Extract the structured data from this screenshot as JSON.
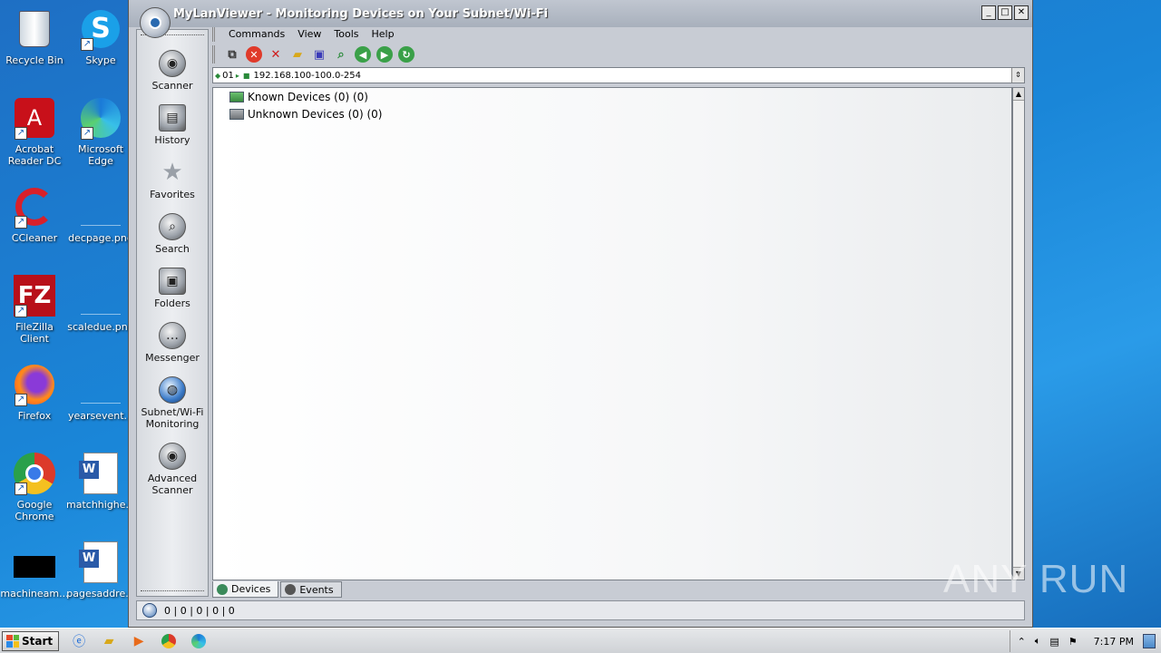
{
  "desktop": {
    "icons": [
      {
        "label": "Recycle Bin",
        "name": "recycle-bin-icon"
      },
      {
        "label": "Skype",
        "name": "skype-icon"
      },
      {
        "label": "Acrobat Reader DC",
        "name": "acrobat-icon"
      },
      {
        "label": "Microsoft Edge",
        "name": "edge-icon"
      },
      {
        "label": "CCleaner",
        "name": "ccleaner-icon"
      },
      {
        "label": "decpage.png",
        "name": "png-file-icon"
      },
      {
        "label": "FileZilla Client",
        "name": "filezilla-icon"
      },
      {
        "label": "scaledue.png",
        "name": "png-file-icon"
      },
      {
        "label": "Firefox",
        "name": "firefox-icon"
      },
      {
        "label": "yearsevent...",
        "name": "file-icon"
      },
      {
        "label": "Google Chrome",
        "name": "chrome-icon"
      },
      {
        "label": "matchhighe...",
        "name": "word-doc-icon"
      },
      {
        "label": "machineam...",
        "name": "black-file-icon"
      },
      {
        "label": "pagesaddre...",
        "name": "word-doc-icon"
      }
    ]
  },
  "window": {
    "title": "MyLanViewer - Monitoring Devices on Your Subnet/Wi-Fi",
    "minimize": "_",
    "maximize": "□",
    "close": "✕"
  },
  "sidebar": {
    "items": [
      {
        "label": "Scanner"
      },
      {
        "label": "History"
      },
      {
        "label": "Favorites"
      },
      {
        "label": "Search"
      },
      {
        "label": "Folders"
      },
      {
        "label": "Messenger"
      },
      {
        "label": "Subnet/Wi-Fi Monitoring"
      },
      {
        "label": "Advanced Scanner"
      }
    ]
  },
  "menu": {
    "commands": "Commands",
    "view": "View",
    "tools": "Tools",
    "help": "Help"
  },
  "address": {
    "prefix": "01",
    "range": "192.168.100-100.0-254"
  },
  "tree": {
    "known": "Known Devices (0) (0)",
    "unknown": "Unknown Devices (0) (0)"
  },
  "tabs": {
    "devices": "Devices",
    "events": "Events"
  },
  "status": {
    "text": "0 | 0 | 0 | 0 | 0"
  },
  "watermark": "ANY RUN",
  "taskbar": {
    "start": "Start",
    "time": "7:17 PM"
  }
}
